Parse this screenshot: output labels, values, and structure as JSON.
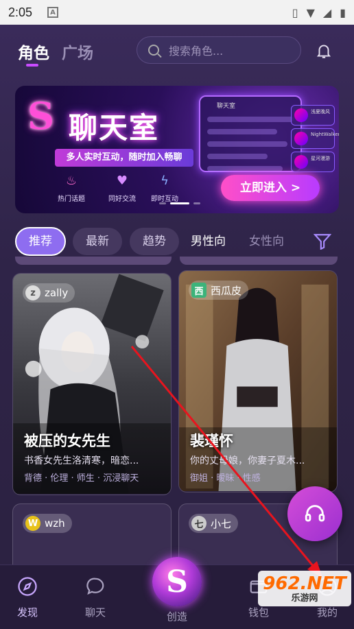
{
  "status": {
    "time": "2:05",
    "notif_icon": "A"
  },
  "header": {
    "tabs": [
      {
        "label": "角色"
      },
      {
        "label": "广场"
      }
    ],
    "search_placeholder": "搜索角色..."
  },
  "banner": {
    "logo": "S",
    "title": "聊天室",
    "subtitle": "多人实时互动，随时加入畅聊",
    "features": [
      {
        "label": "热门话题"
      },
      {
        "label": "同好交流"
      },
      {
        "label": "即时互动"
      }
    ],
    "mock_title": "聊天室",
    "users": [
      "浅夏晚风",
      "NightWalker",
      "星河漫游"
    ],
    "cta": "立即进入 >"
  },
  "filters": {
    "chips": [
      {
        "label": "推荐"
      },
      {
        "label": "最新"
      },
      {
        "label": "趋势"
      }
    ],
    "text_tabs": [
      {
        "label": "男性向"
      },
      {
        "label": "女性向"
      }
    ]
  },
  "cards": [
    {
      "author": "zally",
      "author_initial": "z",
      "name": "被压的女先生",
      "desc": "书香女先生洛清寒，暗恋...",
      "tags": "背德 · 伦理 · 师生 · 沉浸聊天"
    },
    {
      "author": "西瓜皮",
      "author_initial": "西",
      "name": "裴瑾怀",
      "desc": "你的丈母娘，你妻子夏木...",
      "tags": "御姐 · 暧昧 · 性感"
    },
    {
      "author": "wzh",
      "author_initial": "W"
    },
    {
      "author": "小七",
      "author_initial": "七"
    }
  ],
  "nav": {
    "items": [
      {
        "label": "发现"
      },
      {
        "label": "聊天"
      },
      {
        "label": "创造"
      },
      {
        "label": "钱包"
      },
      {
        "label": "我的"
      }
    ],
    "create_glyph": "S"
  },
  "watermark": {
    "big": "962.NET",
    "small": "乐游网"
  },
  "colors": {
    "accent": "#8e6df0",
    "brand_pink": "#ff4fd8",
    "arrow": "#e8141e"
  }
}
